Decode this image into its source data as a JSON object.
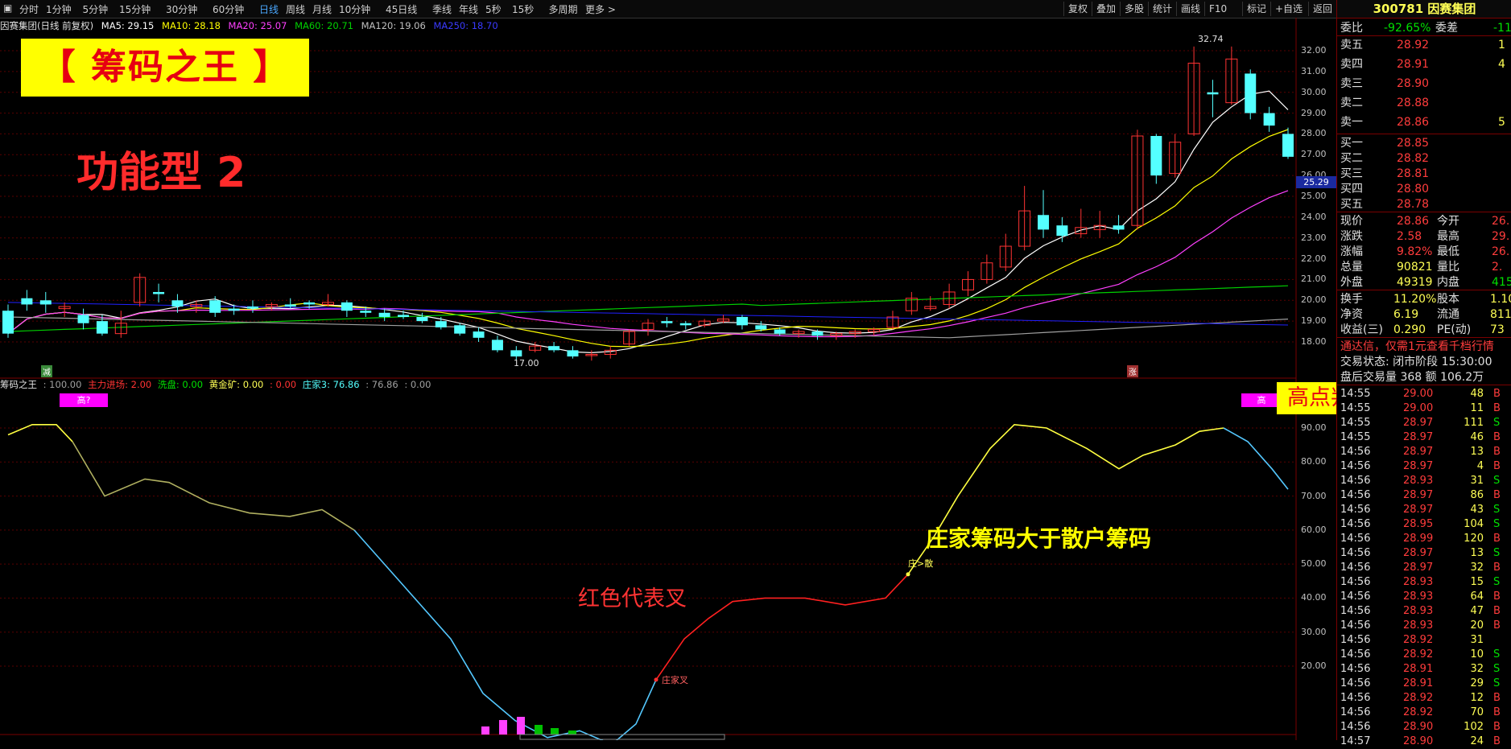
{
  "toolbar": {
    "periods": [
      "分时",
      "1分钟",
      "5分钟",
      "15分钟",
      "30分钟",
      "60分钟",
      "日线",
      "周线",
      "月线",
      "10分钟",
      "45日线",
      "季线",
      "年线",
      "5秒",
      "15秒",
      "多周期",
      "更多 >"
    ],
    "active_period": "日线",
    "right_buttons": [
      "复权",
      "叠加",
      "多股",
      "统计",
      "画线",
      "F10",
      "标记",
      "+自选",
      "返回"
    ]
  },
  "chart_header": {
    "stock": "因赛集团(日线 前复权)",
    "ma5": "MA5: 29.15",
    "ma10": "MA10: 28.18",
    "ma20": "MA20: 25.07",
    "ma60": "MA60: 20.71",
    "ma120": "MA120: 19.06",
    "ma250": "MA250: 18.70"
  },
  "colors": {
    "ma5": "#ffffff",
    "ma10": "#ffff00",
    "ma20": "#ff40ff",
    "ma60": "#00d000",
    "ma120": "#a0a0a0",
    "ma250": "#2020ff",
    "up": "#ff3333",
    "down": "#54ffff"
  },
  "price_axis": [
    "32.00",
    "31.00",
    "30.00",
    "29.00",
    "28.00",
    "27.00",
    "26.00",
    "25.00",
    "24.00",
    "23.00",
    "22.00",
    "21.00",
    "20.00",
    "19.00",
    "18.00"
  ],
  "price_marks": {
    "high": "32.74",
    "low": "17.00",
    "current_price_tag": "25.29"
  },
  "candle_tags": {
    "left": "减",
    "right": "涨"
  },
  "indicator_header": {
    "name": "筹码之王",
    "v1": ": 100.00",
    "main_in": "主力进场: 2.00",
    "wash": "洗盘: 0.00",
    "gold": "黄金矿: 0.00",
    "v2": ": 0.00",
    "zhuang3": "庄家3: 76.86",
    "v3": ": 76.86",
    "v4": ": 0.00"
  },
  "indicator_axis": [
    "90.00",
    "80.00",
    "70.00",
    "60.00",
    "50.00",
    "40.00",
    "30.00",
    "20.00"
  ],
  "indicator_tags": {
    "high_left": "高?",
    "high_right": "高",
    "cross": "庄家叉",
    "zhuang_gt": "庄>散"
  },
  "banners": {
    "title": "【 筹码之王 】",
    "func": "功能型  2",
    "high_point": "高点判断",
    "red_note": "红色代表叉",
    "yellow_note": "庄家筹码大于散户筹码"
  },
  "quote": {
    "code_name": "300781 因赛集团",
    "webi_label": "委比",
    "webi_value": "-92.65%",
    "weicha_label": "委差",
    "weicha_value": "-11",
    "sell": [
      {
        "label": "卖五",
        "price": "28.92",
        "vol": "1"
      },
      {
        "label": "卖四",
        "price": "28.91",
        "vol": "4"
      },
      {
        "label": "卖三",
        "price": "28.90",
        "vol": ""
      },
      {
        "label": "卖二",
        "price": "28.88",
        "vol": ""
      },
      {
        "label": "卖一",
        "price": "28.86",
        "vol": "5"
      }
    ],
    "buy": [
      {
        "label": "买一",
        "price": "28.85",
        "vol": ""
      },
      {
        "label": "买二",
        "price": "28.82",
        "vol": ""
      },
      {
        "label": "买三",
        "price": "28.81",
        "vol": ""
      },
      {
        "label": "买四",
        "price": "28.80",
        "vol": ""
      },
      {
        "label": "买五",
        "price": "28.78",
        "vol": ""
      }
    ],
    "stats": [
      {
        "l1": "现价",
        "v1": "28.86",
        "l2": "今开",
        "v2": "26."
      },
      {
        "l1": "涨跌",
        "v1": "2.58",
        "l2": "最高",
        "v2": "29."
      },
      {
        "l1": "涨幅",
        "v1": "9.82%",
        "l2": "最低",
        "v2": "26."
      },
      {
        "l1": "总量",
        "v1": "90821",
        "l2": "量比",
        "v2": "2."
      },
      {
        "l1": "外盘",
        "v1": "49319",
        "l2": "内盘",
        "v2": "415"
      }
    ],
    "stats2": [
      {
        "l1": "换手",
        "v1": "11.20%",
        "l2": "股本",
        "v2": "1.10"
      },
      {
        "l1": "净资",
        "v1": "6.19",
        "l2": "流通",
        "v2": "8110"
      },
      {
        "l1": "收益(三)",
        "v1": "0.290",
        "l2": "PE(动)",
        "v2": "73"
      }
    ],
    "notice": "通达信，仅需1元查看千档行情",
    "status": "交易状态: 闭市阶段 15:30:00",
    "after": "盘后交易量 368 额 106.2万"
  },
  "ticks": [
    {
      "t": "14:55",
      "p": "29.00",
      "v": "48",
      "s": "B"
    },
    {
      "t": "14:55",
      "p": "29.00",
      "v": "11",
      "s": "B"
    },
    {
      "t": "14:55",
      "p": "28.97",
      "v": "111",
      "s": "S"
    },
    {
      "t": "14:55",
      "p": "28.97",
      "v": "46",
      "s": "B"
    },
    {
      "t": "14:56",
      "p": "28.97",
      "v": "13",
      "s": "B"
    },
    {
      "t": "14:56",
      "p": "28.97",
      "v": "4",
      "s": "B"
    },
    {
      "t": "14:56",
      "p": "28.93",
      "v": "31",
      "s": "S"
    },
    {
      "t": "14:56",
      "p": "28.97",
      "v": "86",
      "s": "B"
    },
    {
      "t": "14:56",
      "p": "28.97",
      "v": "43",
      "s": "S"
    },
    {
      "t": "14:56",
      "p": "28.95",
      "v": "104",
      "s": "S"
    },
    {
      "t": "14:56",
      "p": "28.99",
      "v": "120",
      "s": "B"
    },
    {
      "t": "14:56",
      "p": "28.97",
      "v": "13",
      "s": "S"
    },
    {
      "t": "14:56",
      "p": "28.97",
      "v": "32",
      "s": "B"
    },
    {
      "t": "14:56",
      "p": "28.93",
      "v": "15",
      "s": "S"
    },
    {
      "t": "14:56",
      "p": "28.93",
      "v": "64",
      "s": "B"
    },
    {
      "t": "14:56",
      "p": "28.93",
      "v": "47",
      "s": "B"
    },
    {
      "t": "14:56",
      "p": "28.93",
      "v": "20",
      "s": "B"
    },
    {
      "t": "14:56",
      "p": "28.92",
      "v": "31",
      "s": ""
    },
    {
      "t": "14:56",
      "p": "28.92",
      "v": "10",
      "s": "S"
    },
    {
      "t": "14:56",
      "p": "28.91",
      "v": "32",
      "s": "S"
    },
    {
      "t": "14:56",
      "p": "28.91",
      "v": "29",
      "s": "S"
    },
    {
      "t": "14:56",
      "p": "28.92",
      "v": "12",
      "s": "B"
    },
    {
      "t": "14:56",
      "p": "28.92",
      "v": "70",
      "s": "B"
    },
    {
      "t": "14:56",
      "p": "28.90",
      "v": "102",
      "s": "B"
    },
    {
      "t": "14:57",
      "p": "28.90",
      "v": "24",
      "s": "B"
    }
  ]
}
